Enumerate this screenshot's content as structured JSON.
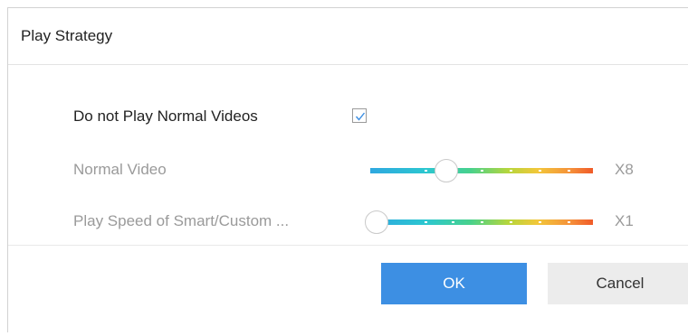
{
  "dialog": {
    "title": "Play Strategy"
  },
  "options": {
    "skip_normal": {
      "label": "Do not Play Normal Videos",
      "checked": true
    },
    "normal_video": {
      "label": "Normal Video",
      "speed": "X8",
      "level_fraction": 0.35
    },
    "smart_speed": {
      "label": "Play Speed of Smart/Custom ...",
      "speed": "X1",
      "level_fraction": 0.0
    }
  },
  "buttons": {
    "ok": "OK",
    "cancel": "Cancel"
  },
  "colors": {
    "ok_button": "#3d8fe3",
    "cancel_button": "#ececec",
    "checkbox_check": "#3d8fe3"
  },
  "icons": {
    "checkbox": "check-icon",
    "slider_thumb": "slider-thumb"
  }
}
